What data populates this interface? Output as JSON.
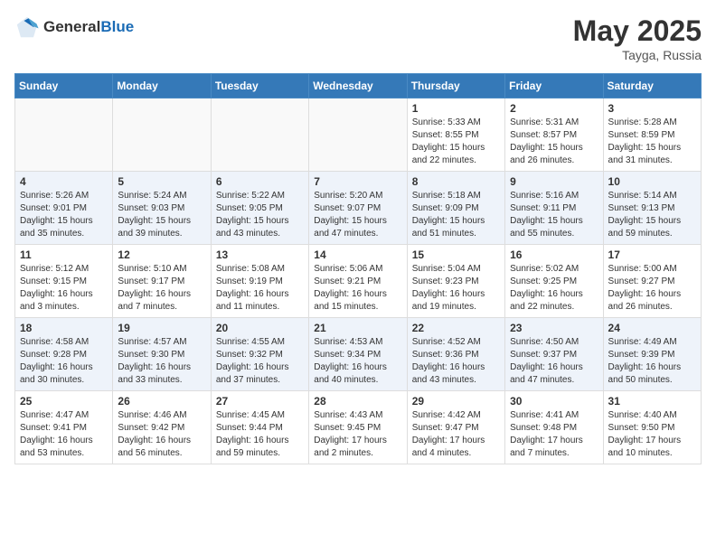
{
  "header": {
    "logo_general": "General",
    "logo_blue": "Blue",
    "title": "May 2025",
    "location": "Tayga, Russia"
  },
  "weekdays": [
    "Sunday",
    "Monday",
    "Tuesday",
    "Wednesday",
    "Thursday",
    "Friday",
    "Saturday"
  ],
  "weeks": [
    [
      {
        "day": "",
        "content": ""
      },
      {
        "day": "",
        "content": ""
      },
      {
        "day": "",
        "content": ""
      },
      {
        "day": "",
        "content": ""
      },
      {
        "day": "1",
        "content": "Sunrise: 5:33 AM\nSunset: 8:55 PM\nDaylight: 15 hours\nand 22 minutes."
      },
      {
        "day": "2",
        "content": "Sunrise: 5:31 AM\nSunset: 8:57 PM\nDaylight: 15 hours\nand 26 minutes."
      },
      {
        "day": "3",
        "content": "Sunrise: 5:28 AM\nSunset: 8:59 PM\nDaylight: 15 hours\nand 31 minutes."
      }
    ],
    [
      {
        "day": "4",
        "content": "Sunrise: 5:26 AM\nSunset: 9:01 PM\nDaylight: 15 hours\nand 35 minutes."
      },
      {
        "day": "5",
        "content": "Sunrise: 5:24 AM\nSunset: 9:03 PM\nDaylight: 15 hours\nand 39 minutes."
      },
      {
        "day": "6",
        "content": "Sunrise: 5:22 AM\nSunset: 9:05 PM\nDaylight: 15 hours\nand 43 minutes."
      },
      {
        "day": "7",
        "content": "Sunrise: 5:20 AM\nSunset: 9:07 PM\nDaylight: 15 hours\nand 47 minutes."
      },
      {
        "day": "8",
        "content": "Sunrise: 5:18 AM\nSunset: 9:09 PM\nDaylight: 15 hours\nand 51 minutes."
      },
      {
        "day": "9",
        "content": "Sunrise: 5:16 AM\nSunset: 9:11 PM\nDaylight: 15 hours\nand 55 minutes."
      },
      {
        "day": "10",
        "content": "Sunrise: 5:14 AM\nSunset: 9:13 PM\nDaylight: 15 hours\nand 59 minutes."
      }
    ],
    [
      {
        "day": "11",
        "content": "Sunrise: 5:12 AM\nSunset: 9:15 PM\nDaylight: 16 hours\nand 3 minutes."
      },
      {
        "day": "12",
        "content": "Sunrise: 5:10 AM\nSunset: 9:17 PM\nDaylight: 16 hours\nand 7 minutes."
      },
      {
        "day": "13",
        "content": "Sunrise: 5:08 AM\nSunset: 9:19 PM\nDaylight: 16 hours\nand 11 minutes."
      },
      {
        "day": "14",
        "content": "Sunrise: 5:06 AM\nSunset: 9:21 PM\nDaylight: 16 hours\nand 15 minutes."
      },
      {
        "day": "15",
        "content": "Sunrise: 5:04 AM\nSunset: 9:23 PM\nDaylight: 16 hours\nand 19 minutes."
      },
      {
        "day": "16",
        "content": "Sunrise: 5:02 AM\nSunset: 9:25 PM\nDaylight: 16 hours\nand 22 minutes."
      },
      {
        "day": "17",
        "content": "Sunrise: 5:00 AM\nSunset: 9:27 PM\nDaylight: 16 hours\nand 26 minutes."
      }
    ],
    [
      {
        "day": "18",
        "content": "Sunrise: 4:58 AM\nSunset: 9:28 PM\nDaylight: 16 hours\nand 30 minutes."
      },
      {
        "day": "19",
        "content": "Sunrise: 4:57 AM\nSunset: 9:30 PM\nDaylight: 16 hours\nand 33 minutes."
      },
      {
        "day": "20",
        "content": "Sunrise: 4:55 AM\nSunset: 9:32 PM\nDaylight: 16 hours\nand 37 minutes."
      },
      {
        "day": "21",
        "content": "Sunrise: 4:53 AM\nSunset: 9:34 PM\nDaylight: 16 hours\nand 40 minutes."
      },
      {
        "day": "22",
        "content": "Sunrise: 4:52 AM\nSunset: 9:36 PM\nDaylight: 16 hours\nand 43 minutes."
      },
      {
        "day": "23",
        "content": "Sunrise: 4:50 AM\nSunset: 9:37 PM\nDaylight: 16 hours\nand 47 minutes."
      },
      {
        "day": "24",
        "content": "Sunrise: 4:49 AM\nSunset: 9:39 PM\nDaylight: 16 hours\nand 50 minutes."
      }
    ],
    [
      {
        "day": "25",
        "content": "Sunrise: 4:47 AM\nSunset: 9:41 PM\nDaylight: 16 hours\nand 53 minutes."
      },
      {
        "day": "26",
        "content": "Sunrise: 4:46 AM\nSunset: 9:42 PM\nDaylight: 16 hours\nand 56 minutes."
      },
      {
        "day": "27",
        "content": "Sunrise: 4:45 AM\nSunset: 9:44 PM\nDaylight: 16 hours\nand 59 minutes."
      },
      {
        "day": "28",
        "content": "Sunrise: 4:43 AM\nSunset: 9:45 PM\nDaylight: 17 hours\nand 2 minutes."
      },
      {
        "day": "29",
        "content": "Sunrise: 4:42 AM\nSunset: 9:47 PM\nDaylight: 17 hours\nand 4 minutes."
      },
      {
        "day": "30",
        "content": "Sunrise: 4:41 AM\nSunset: 9:48 PM\nDaylight: 17 hours\nand 7 minutes."
      },
      {
        "day": "31",
        "content": "Sunrise: 4:40 AM\nSunset: 9:50 PM\nDaylight: 17 hours\nand 10 minutes."
      }
    ]
  ]
}
